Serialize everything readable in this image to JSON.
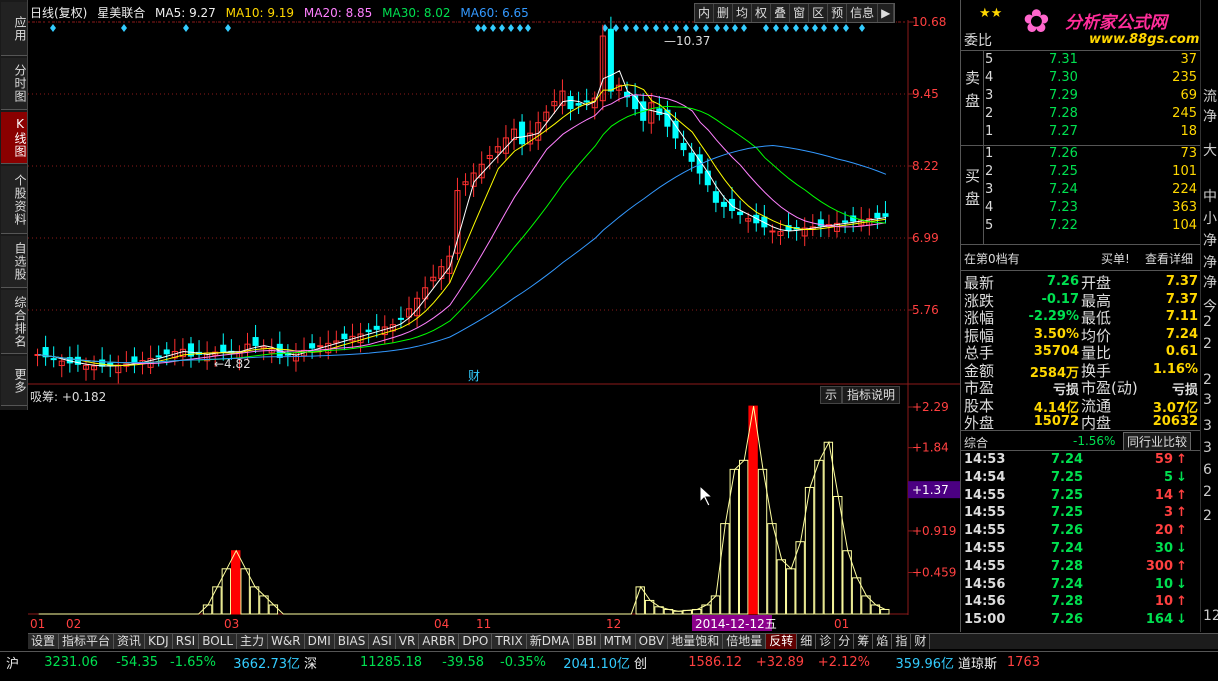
{
  "left_nav": [
    {
      "label": "应用"
    },
    {
      "label": "分时图"
    },
    {
      "label": "K线图",
      "active": true
    },
    {
      "label": "个股资料"
    },
    {
      "label": "自选股"
    },
    {
      "label": "综合排名"
    },
    {
      "label": "更多"
    }
  ],
  "chart_header": {
    "period": "日线(复权)",
    "name": "星美联合",
    "ma5": "MA5: 9.27",
    "ma10": "MA10: 9.19",
    "ma20": "MA20: 8.85",
    "ma30": "MA30: 8.02",
    "ma60": "MA60: 6.65"
  },
  "toolbar": [
    "内",
    "删",
    "均",
    "权",
    "叠",
    "窗",
    "区",
    "预",
    "信息",
    "▶"
  ],
  "colors": {
    "up": "#ff3030",
    "down": "#00ffff",
    "ma5": "#ffffff",
    "ma10": "#ffff00",
    "ma20": "#ff80ff",
    "ma30": "#00ff00",
    "ma60": "#3399ff",
    "grid": "#8b1a1a",
    "bar": "#ffffa0"
  },
  "price_axis": [
    "10.68",
    "9.45",
    "8.22",
    "6.99",
    "5.76"
  ],
  "annotations": {
    "high": "10.37",
    "low": "4.82",
    "cai": "财",
    "date_label": "2014-12-12五"
  },
  "date_axis": [
    "01",
    "02",
    "03",
    "04",
    "11",
    "12",
    "01"
  ],
  "indicator": {
    "title": "吸筹: +0.182",
    "tab_partial": "示",
    "tab_explain": "指标说明",
    "axis": [
      "+2.29",
      "+1.84",
      "+1.37",
      "+0.919",
      "+0.459"
    ]
  },
  "chart_data": {
    "type": "bar",
    "title": "吸筹",
    "values": [
      0,
      0,
      0,
      0,
      0,
      0,
      0,
      0,
      0,
      0,
      0,
      0,
      0,
      0,
      0,
      0,
      0,
      0,
      0.1,
      0.3,
      0.5,
      0.7,
      0.5,
      0.3,
      0.2,
      0.1,
      0,
      0,
      0,
      0,
      0,
      0,
      0,
      0,
      0,
      0,
      0,
      0,
      0,
      0,
      0,
      0,
      0,
      0,
      0,
      0,
      0,
      0,
      0,
      0,
      0,
      0,
      0,
      0,
      0,
      0,
      0,
      0,
      0,
      0,
      0,
      0,
      0,
      0,
      0.3,
      0.15,
      0.08,
      0.05,
      0.03,
      0.04,
      0.05,
      0.1,
      0.2,
      1.0,
      1.6,
      1.7,
      2.3,
      1.6,
      1.0,
      0.6,
      0.5,
      0.8,
      1.4,
      1.7,
      1.9,
      1.3,
      0.7,
      0.4,
      0.2,
      0.1,
      0.05
    ],
    "ylim": [
      0,
      2.29
    ]
  },
  "quote": {
    "committee": "委比",
    "sell_label": "卖盘",
    "buy_label": "买盘",
    "sell": [
      [
        "5",
        "7.31",
        "37"
      ],
      [
        "4",
        "7.30",
        "235"
      ],
      [
        "3",
        "7.29",
        "69"
      ],
      [
        "2",
        "7.28",
        "245"
      ],
      [
        "1",
        "7.27",
        "18"
      ]
    ],
    "buy": [
      [
        "1",
        "7.26",
        "73"
      ],
      [
        "2",
        "7.25",
        "101"
      ],
      [
        "3",
        "7.24",
        "224"
      ],
      [
        "4",
        "7.23",
        "363"
      ],
      [
        "5",
        "7.22",
        "104"
      ]
    ],
    "tier_text": "在第0档有",
    "buy_single": "买单!",
    "detail": "查看详细",
    "stats": [
      [
        "最新",
        "7.26",
        "开盘",
        "7.37"
      ],
      [
        "涨跌",
        "-0.17",
        "最高",
        "7.37"
      ],
      [
        "涨幅",
        "-2.29%",
        "最低",
        "7.11"
      ],
      [
        "振幅",
        "3.50%",
        "均价",
        "7.24"
      ],
      [
        "总手",
        "35704",
        "量比",
        "0.61"
      ],
      [
        "金额",
        "2584万",
        "换手",
        "1.16%"
      ],
      [
        "市盈",
        "亏损",
        "市盈(动)",
        "亏损"
      ],
      [
        "股本",
        "4.14亿",
        "流通",
        "3.07亿"
      ],
      [
        "外盘",
        "15072",
        "内盘",
        "20632"
      ]
    ],
    "composite_label": "综合",
    "composite_value": "-1.56%",
    "industry": "同行业比较",
    "ticks": [
      [
        "14:53",
        "7.24",
        "59",
        "↑"
      ],
      [
        "14:54",
        "7.25",
        "5",
        "↓"
      ],
      [
        "14:55",
        "7.25",
        "14",
        "↑"
      ],
      [
        "14:55",
        "7.25",
        "3",
        "↑"
      ],
      [
        "14:55",
        "7.26",
        "20",
        "↑"
      ],
      [
        "14:55",
        "7.24",
        "30",
        "↓"
      ],
      [
        "14:55",
        "7.28",
        "300",
        "↑"
      ],
      [
        "14:56",
        "7.24",
        "10",
        "↓"
      ],
      [
        "14:56",
        "7.28",
        "10",
        "↑"
      ],
      [
        "15:00",
        "7.26",
        "164",
        "↓"
      ]
    ]
  },
  "logo": {
    "text": "分析家公式网",
    "url": "www.88gs.com"
  },
  "far_right": [
    "流",
    "净",
    "大",
    "中",
    "小",
    "净",
    "净",
    "净",
    "今",
    "2",
    "2",
    "2",
    "3",
    "3",
    "3",
    "6",
    "2",
    "2",
    "12"
  ],
  "bottom_tabs": [
    "设置",
    "指标平台",
    "资讯",
    "KDJ",
    "RSI",
    "BOLL",
    "主力",
    "W&R",
    "DMI",
    "BIAS",
    "ASI",
    "VR",
    "ARBR",
    "DPO",
    "TRIX",
    "新DMA",
    "BBI",
    "MTM",
    "OBV",
    "地量饱和",
    "倍地量",
    "反转",
    "细",
    "诊",
    "分",
    "筹",
    "焰",
    "指",
    "财"
  ],
  "status_bar": [
    {
      "t": "沪",
      "c": "white"
    },
    {
      "t": "3231.06",
      "c": "green"
    },
    {
      "t": "-54.35",
      "c": "green"
    },
    {
      "t": "-1.65%",
      "c": "green"
    },
    {
      "t": "3662.73亿",
      "c": "cyan"
    },
    {
      "t": "深",
      "c": "white"
    },
    {
      "t": "11285.18",
      "c": "green"
    },
    {
      "t": "-39.58",
      "c": "green"
    },
    {
      "t": "-0.35%",
      "c": "green"
    },
    {
      "t": "2041.10亿",
      "c": "cyan"
    },
    {
      "t": "创",
      "c": "white"
    },
    {
      "t": "1586.12",
      "c": "red"
    },
    {
      "t": "+32.89",
      "c": "red"
    },
    {
      "t": "+2.12%",
      "c": "red"
    },
    {
      "t": "359.96亿",
      "c": "cyan"
    },
    {
      "t": "道琼斯",
      "c": "white"
    },
    {
      "t": "1763",
      "c": "red"
    }
  ]
}
